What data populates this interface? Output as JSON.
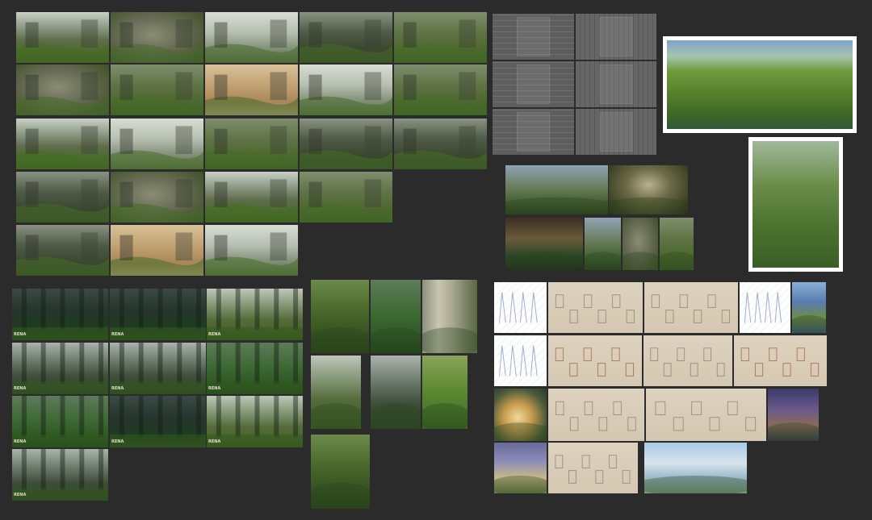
{
  "board": {
    "background": "#2b2b2b"
  },
  "captions": {
    "ruins": "",
    "forest_logo": "RENA",
    "watermark": "",
    "sheet": ""
  },
  "groups": {
    "ruins_grid": {
      "name": "ruins concept thumbnails",
      "tiles": 22
    },
    "texture_sheets": {
      "name": "stone texture sheets",
      "tiles": 6
    },
    "framed_paintings": {
      "name": "framed overgrown ruin paintings",
      "tiles": 2
    },
    "ruin_photos": {
      "name": "ruin reference photos",
      "tiles": 6
    },
    "forest_renders": {
      "name": "forest environment renders",
      "tiles": 10
    },
    "forest_photos": {
      "name": "forest reference photos",
      "tiles": 7
    },
    "sketch_sheets": {
      "name": "prop and character sketch sheets",
      "tiles": 16
    }
  },
  "palette": {
    "grass": "#4d7a2c",
    "moss": "#3d5a22",
    "stone": "#6c705e",
    "sky": "#aab7a8",
    "parchment": "#d9cdb8",
    "ink_red": "#8c3a2c",
    "ink_blue": "#5a6ea8"
  }
}
